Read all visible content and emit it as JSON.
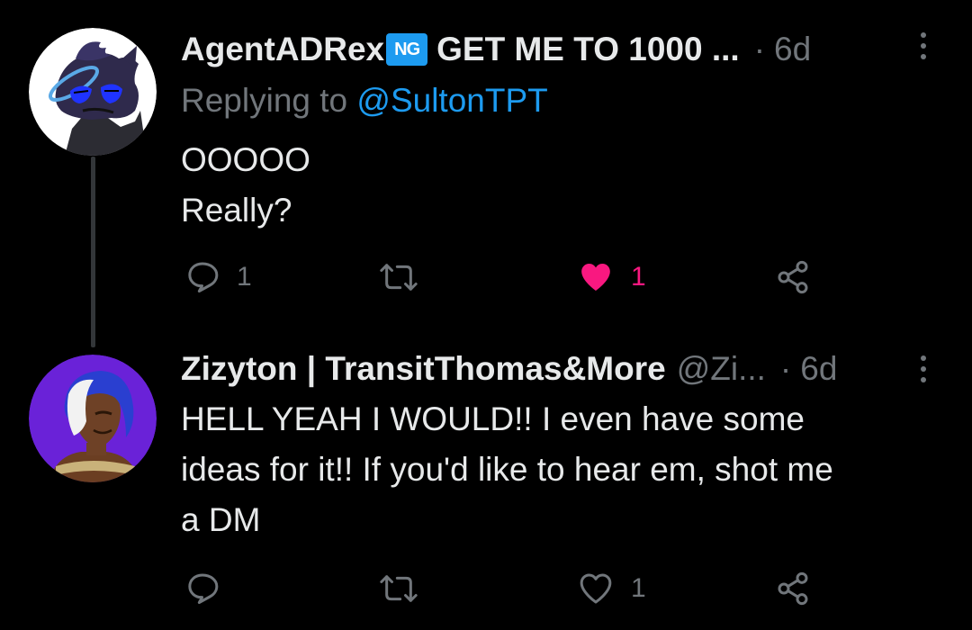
{
  "tweets": [
    {
      "display_name": "AgentADRex",
      "badge": "NG",
      "name_suffix": "GET ME TO 1000 ...",
      "handle": "",
      "separator": "·",
      "time": "6d",
      "replying_prefix": "Replying to ",
      "replying_to": "@SultonTPT",
      "body": "OOOOO\nReally?",
      "actions": {
        "reply_count": "1",
        "retweet_count": "",
        "like_count": "1",
        "liked": true
      },
      "avatar_icon": "avatar-blue-dragon-halo",
      "colors": {
        "halo": "#5aa9e6",
        "eyes": "#1f33ff"
      }
    },
    {
      "display_name": "Zizyton | TransitThomas&More",
      "handle": "@Zi...",
      "separator": "·",
      "time": "6d",
      "body": "HELL YEAH I WOULD!! I even have some\nideas for it!! If you'd like to hear em, shot me\na DM",
      "actions": {
        "reply_count": "",
        "retweet_count": "",
        "like_count": "1",
        "liked": false
      },
      "avatar_icon": "avatar-purple-character"
    }
  ],
  "icons": {
    "reply": "reply-icon",
    "retweet": "retweet-icon",
    "like": "heart-icon",
    "share": "share-icon",
    "more": "more-icon"
  },
  "colors": {
    "background": "#000000",
    "text": "#e7e9ea",
    "muted": "#71767b",
    "link": "#1d9bf0",
    "like_active": "#f91880"
  }
}
